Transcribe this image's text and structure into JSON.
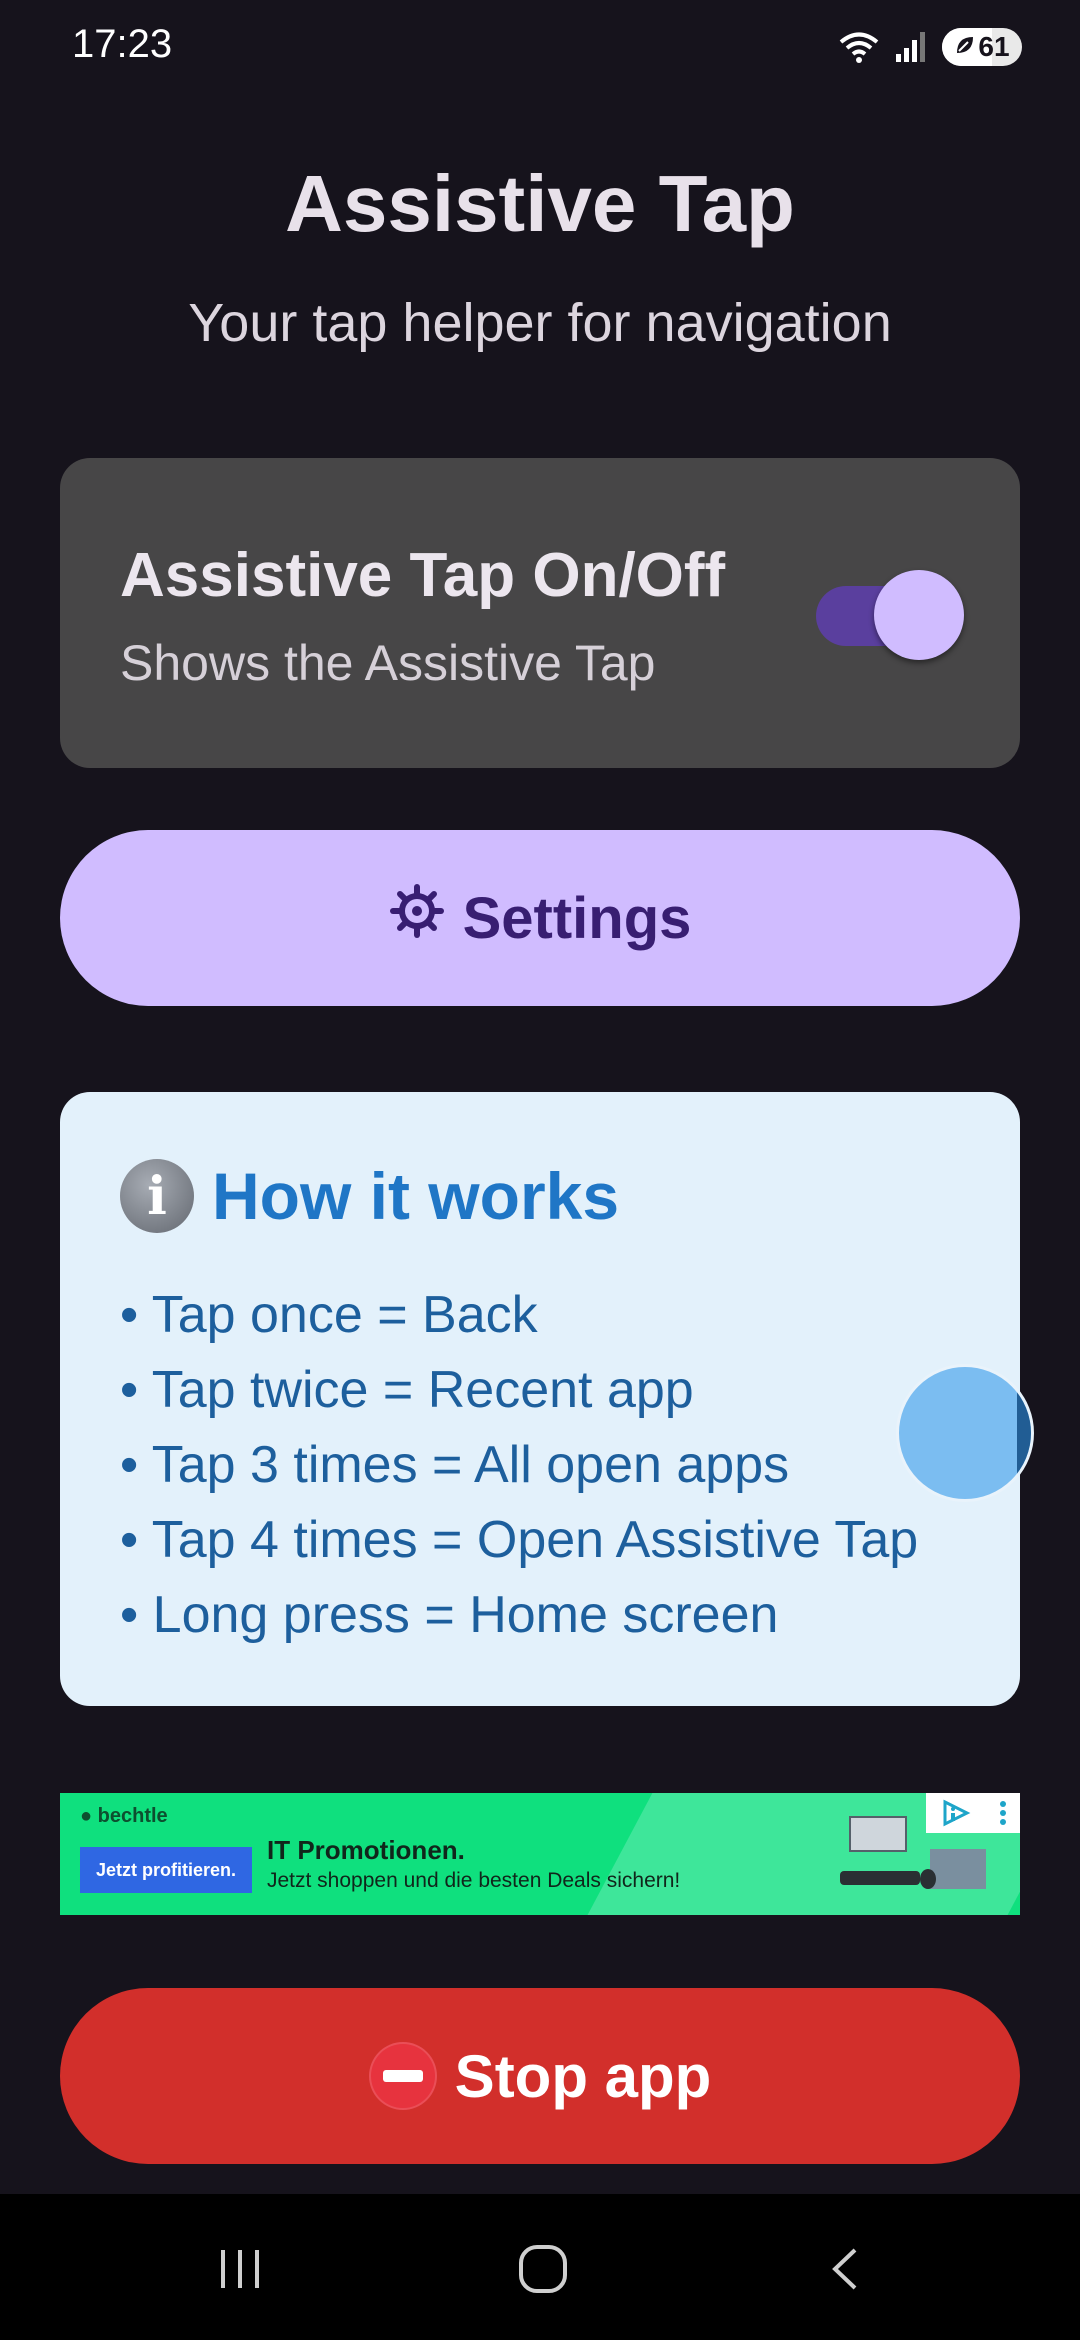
{
  "status_bar": {
    "time": "17:23",
    "battery": "61"
  },
  "header": {
    "title": "Assistive Tap",
    "subtitle": "Your tap helper for navigation"
  },
  "toggle_card": {
    "title": "Assistive Tap On/Off",
    "description": "Shows the Assistive Tap",
    "enabled": true
  },
  "settings_button": {
    "icon": "gear-icon",
    "label": "Settings"
  },
  "info_card": {
    "icon": "info-icon",
    "title": "How it works",
    "items": [
      "• Tap once = Back",
      "• Tap twice = Recent app",
      "• Tap 3 times = All open apps",
      "• Tap 4 times = Open Assistive Tap",
      "• Long press = Home screen"
    ]
  },
  "ad": {
    "brand": "bechtle",
    "cta": "Jetzt profitieren.",
    "headline": "IT Promotionen.",
    "text": "Jetzt shoppen und die besten Deals sichern!"
  },
  "stop_button": {
    "icon": "no-entry-icon",
    "label": "Stop app"
  },
  "colors": {
    "background": "#16131c",
    "accent": "#d0bcff",
    "stop": "#d22f2b",
    "info_card": "#e3f1fb",
    "info_title": "#1f76c6"
  }
}
